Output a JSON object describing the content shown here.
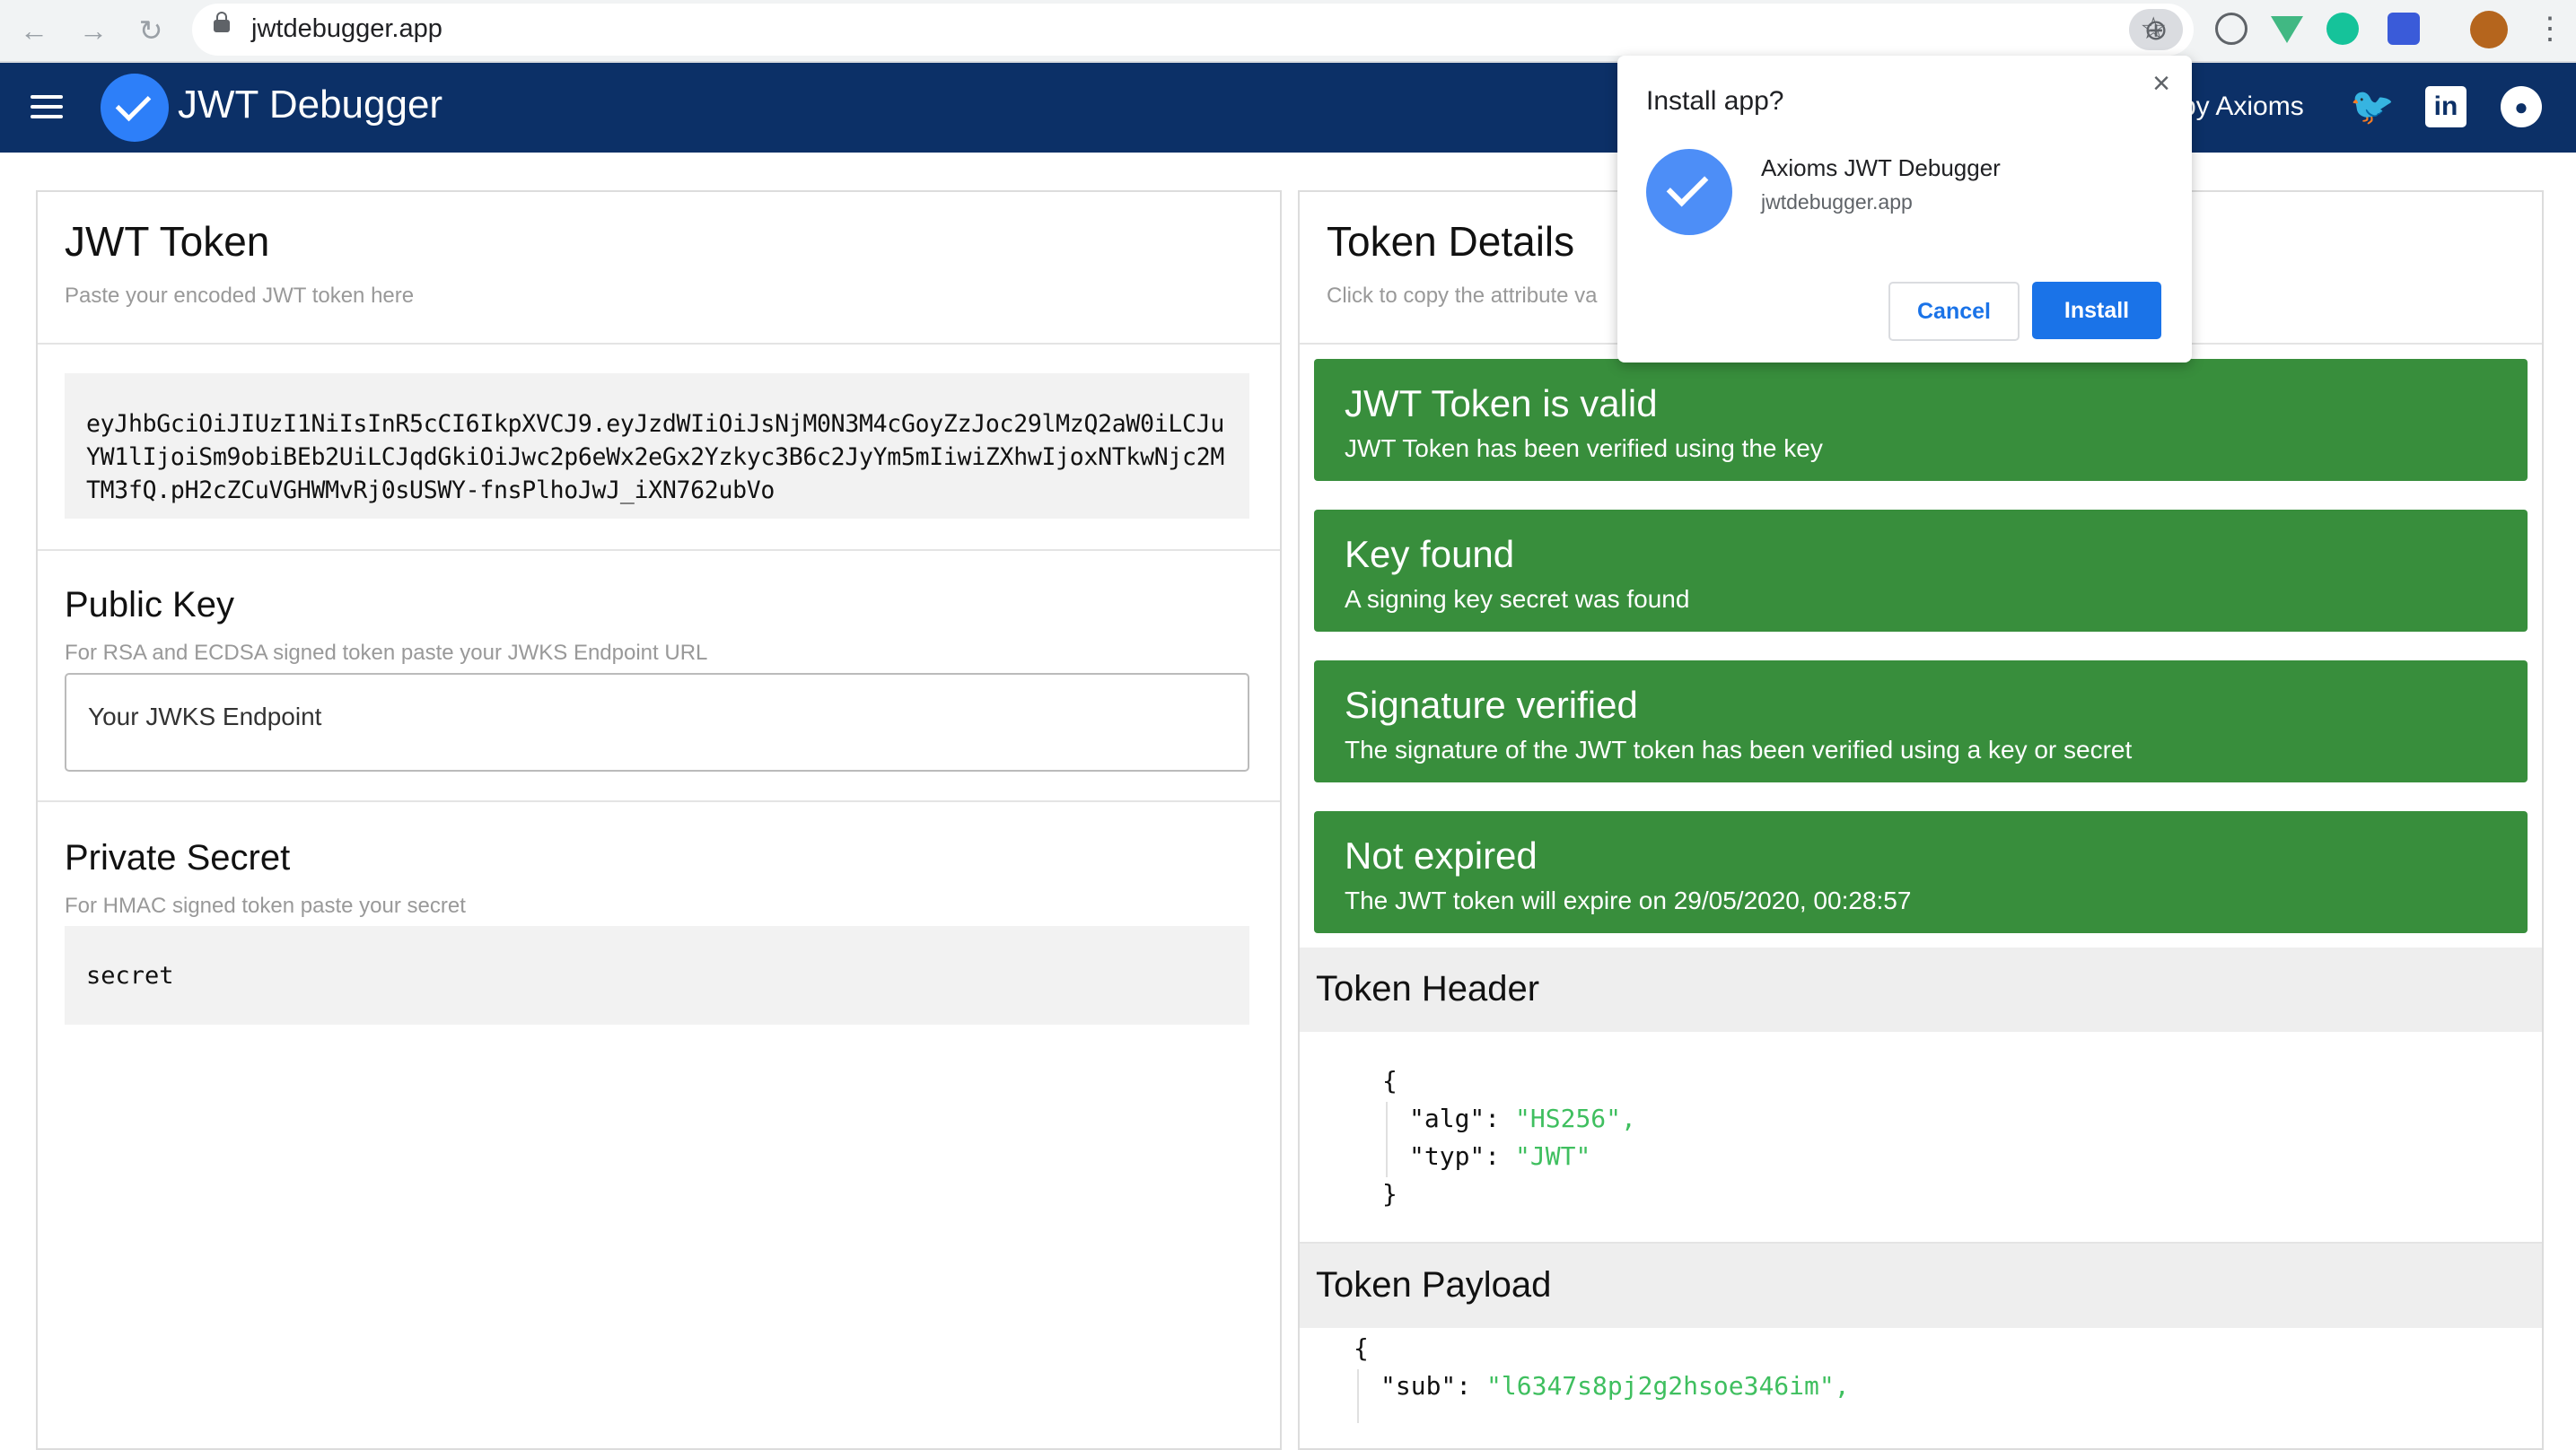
{
  "browser": {
    "url": "jwtdebugger.app"
  },
  "app": {
    "title": "JWT Debugger",
    "by_label": "by Axioms",
    "brand_color": "#0c3067"
  },
  "jwt_token": {
    "title": "JWT Token",
    "subtitle": "Paste your encoded JWT token here",
    "value": "eyJhbGciOiJIUzI1NiIsInR5cCI6IkpXVCJ9.eyJzdWIiOiJsNjM0N3M4cGoyZzJoc29lMzQ2aW0iLCJuYW1lIjoiSm9obiBEb2UiLCJqdGkiOiJwc2p6eWx2eGx2Yzkyc3B6c2JyYm5mIiwiZXhwIjoxNTkwNjc2MTM3fQ.pH2cZCuVGHWMvRj0sUSWY-fnsPlhoJwJ_iXN762ubVo"
  },
  "public_key": {
    "title": "Public Key",
    "subtitle": "For RSA and ECDSA signed token paste your JWKS Endpoint URL",
    "placeholder": "Your JWKS Endpoint"
  },
  "private_secret": {
    "title": "Private Secret",
    "subtitle": "For HMAC signed token paste your secret",
    "value": "secret"
  },
  "token_details": {
    "title": "Token Details",
    "subtitle": "Click to copy the attribute va",
    "statuses": [
      {
        "title": "JWT Token is valid",
        "desc": "JWT Token has been verified using the key"
      },
      {
        "title": "Key found",
        "desc": "A signing key secret was found"
      },
      {
        "title": "Signature verified",
        "desc": "The signature of the JWT token has been verified using a key or secret"
      },
      {
        "title": "Not expired",
        "desc": "The JWT token will expire on 29/05/2020, 00:28:57"
      }
    ],
    "status_color": "#388e3c"
  },
  "token_header": {
    "title": "Token Header",
    "open_brace": "{",
    "close_brace": "}",
    "alg_key": "\"alg\"",
    "alg_value": "\"HS256\",",
    "typ_key": "\"typ\"",
    "typ_value": "\"JWT\""
  },
  "token_payload": {
    "title": "Token Payload",
    "open_brace": "{",
    "sub_key": "\"sub\"",
    "sub_value": "\"l6347s8pj2g2hsoe346im\","
  },
  "install_popup": {
    "title": "Install app?",
    "app_name": "Axioms JWT Debugger",
    "host": "jwtdebugger.app",
    "cancel_label": "Cancel",
    "install_label": "Install",
    "close_glyph": "×"
  },
  "icons": [
    "back-icon",
    "forward-icon",
    "reload-icon",
    "lock-icon",
    "install-app-icon",
    "star-icon",
    "menu-icon",
    "check-logo-icon",
    "twitter-icon",
    "linkedin-icon",
    "github-icon",
    "close-icon"
  ]
}
